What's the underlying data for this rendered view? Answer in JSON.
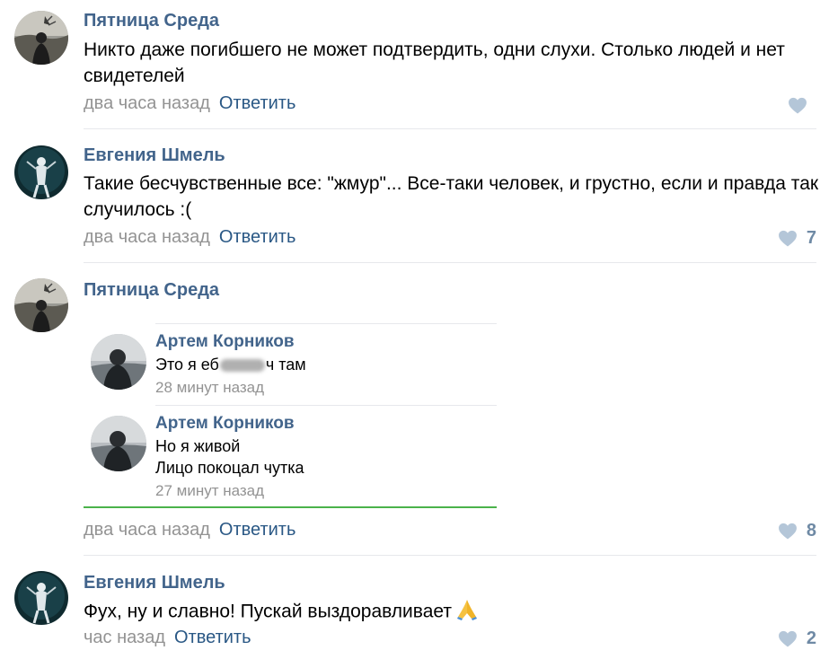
{
  "colors": {
    "author": "#42648b",
    "reply": "#2a5885",
    "time": "#939393",
    "like": "#b4c6d8",
    "quote_bottom": "#4bb34b"
  },
  "comments": [
    {
      "author": "Пятница Среда",
      "text": "Никто даже погибшего не может подтвердить, одни слухи. Столько людей и нет свидетелей",
      "time": "два часа назад",
      "reply_label": "Ответить",
      "likes": ""
    },
    {
      "author": "Евгения Шмель",
      "text": "Такие бесчувственные все: \"жмур\"... Все-таки человек, и грустно, если и правда так случилось :(",
      "time": "два часа назад",
      "reply_label": "Ответить",
      "likes": "7"
    },
    {
      "author": "Пятница Среда",
      "quotes": [
        {
          "author": "Артем Корников",
          "text_start": "Это я еб",
          "text_end": "ч там",
          "time": "28 минут назад"
        },
        {
          "author": "Артем Корников",
          "line1": "Но я живой",
          "line2": "Лицо покоцал чутка",
          "time": "27 минут назад"
        }
      ],
      "time": "два часа назад",
      "reply_label": "Ответить",
      "likes": "8"
    },
    {
      "author": "Евгения Шмель",
      "text": "Фух, ну и славно! Пускай выздоравливает",
      "time": "час назад",
      "reply_label": "Ответить",
      "likes": "2"
    }
  ],
  "icons": {
    "like": "heart-icon",
    "emoji": "praying-hands-icon"
  }
}
